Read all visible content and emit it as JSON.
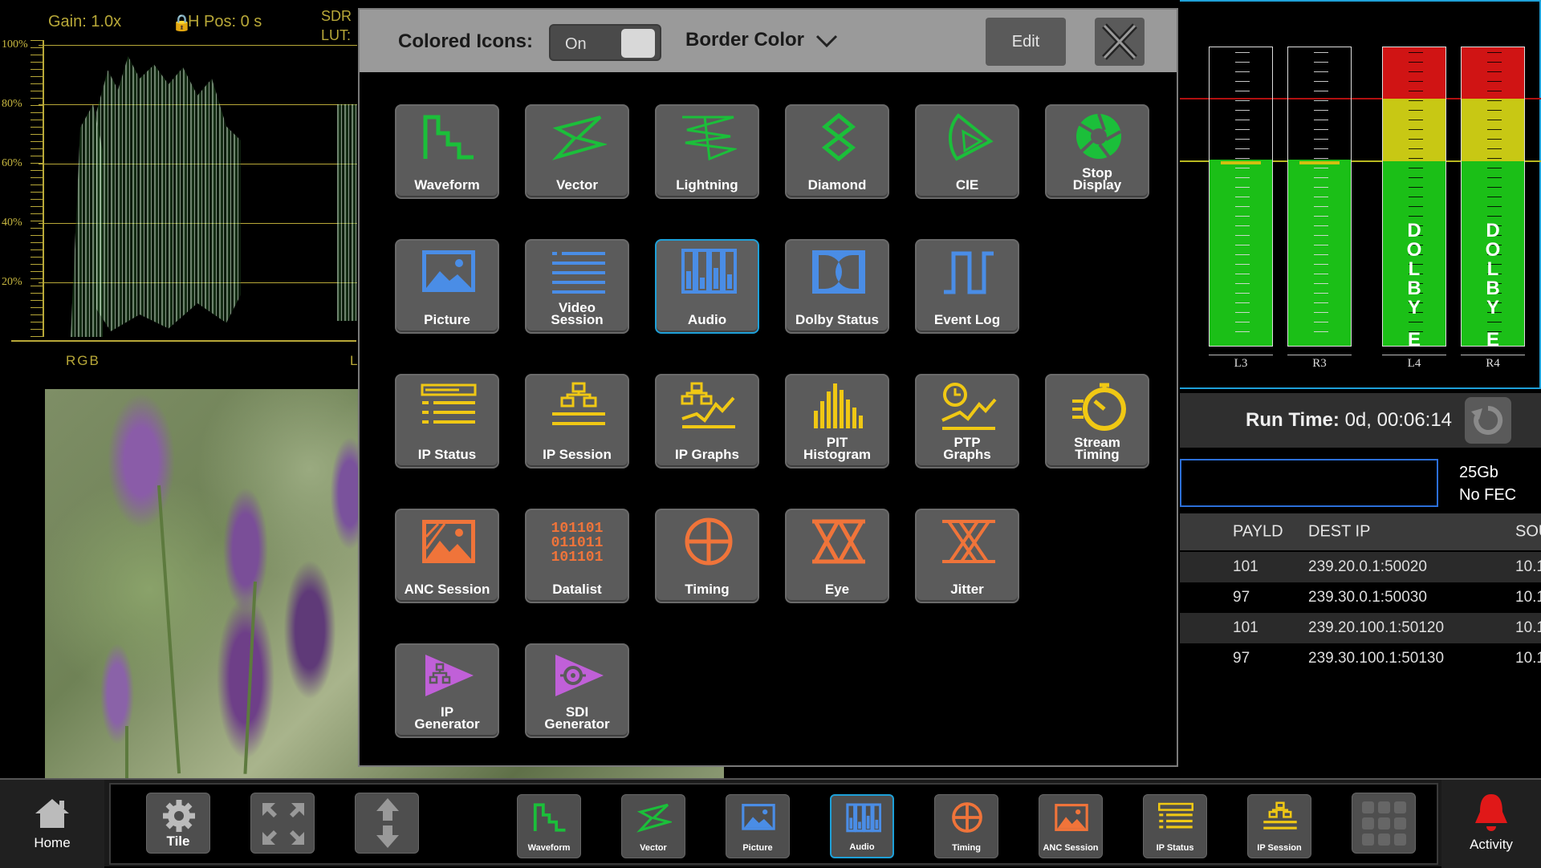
{
  "waveform": {
    "gain": "Gain: 1.0x",
    "hpos": "H Pos: 0 s",
    "sdr": "SDR",
    "lut": "LUT:",
    "scale": [
      "100%",
      "80%",
      "60%",
      "40%",
      "20%"
    ],
    "mode": "RGB",
    "right_mark": "L",
    "colors": {
      "graticule": "#b8a838"
    }
  },
  "audio": {
    "channels": [
      {
        "label": "L3",
        "level": 0.7,
        "dolby": false
      },
      {
        "label": "R3",
        "level": 0.7,
        "dolby": false
      },
      {
        "label": "L4",
        "level": 1.0,
        "dolby": true,
        "dolby_text": [
          "D",
          "O",
          "L",
          "B",
          "Y",
          "E"
        ]
      },
      {
        "label": "R4",
        "level": 1.0,
        "dolby": true,
        "dolby_text": [
          "D",
          "O",
          "L",
          "B",
          "Y",
          "E"
        ]
      }
    ],
    "colors": {
      "green": "#1bbf17",
      "yellow": "#c8c814",
      "red": "#d01414"
    }
  },
  "runtime": {
    "label": "Run Time:",
    "value": "0d, 00:06:14"
  },
  "link": {
    "speed": "25Gb",
    "fec": "No FEC"
  },
  "ip_table": {
    "columns": [
      "PAYLD",
      "DEST IP",
      "SOU"
    ],
    "rows": [
      [
        "101",
        "239.20.0.1:50020",
        "10.1"
      ],
      [
        "97",
        "239.30.0.1:50030",
        "10.1"
      ],
      [
        "101",
        "239.20.100.1:50120",
        "10.1"
      ],
      [
        "97",
        "239.30.100.1:50130",
        "10.1"
      ]
    ]
  },
  "modal": {
    "colored_icons_label": "Colored Icons:",
    "toggle_value": "On",
    "border_color_label": "Border Color",
    "edit_label": "Edit",
    "tiles": [
      {
        "label": "Waveform",
        "icon": "waveform-icon",
        "color": "#1bbf3a"
      },
      {
        "label": "Vector",
        "icon": "vector-icon",
        "color": "#1bbf3a"
      },
      {
        "label": "Lightning",
        "icon": "lightning-icon",
        "color": "#1bbf3a"
      },
      {
        "label": "Diamond",
        "icon": "diamond-icon",
        "color": "#1bbf3a"
      },
      {
        "label": "CIE",
        "icon": "cie-icon",
        "color": "#1bbf3a"
      },
      {
        "label": "Stop\nDisplay",
        "icon": "stop-display-icon",
        "color": "#1bbf3a"
      },
      {
        "label": "Picture",
        "icon": "picture-icon",
        "color": "#4a8de6"
      },
      {
        "label": "Video\nSession",
        "icon": "video-session-icon",
        "color": "#4a8de6"
      },
      {
        "label": "Audio",
        "icon": "audio-icon",
        "color": "#4a8de6",
        "selected": true
      },
      {
        "label": "Dolby Status",
        "icon": "dolby-status-icon",
        "color": "#4a8de6"
      },
      {
        "label": "Event Log",
        "icon": "event-log-icon",
        "color": "#4a8de6"
      },
      {
        "label": "IP Status",
        "icon": "ip-status-icon",
        "color": "#f0c814"
      },
      {
        "label": "IP Session",
        "icon": "ip-session-icon",
        "color": "#f0c814"
      },
      {
        "label": "IP Graphs",
        "icon": "ip-graphs-icon",
        "color": "#f0c814"
      },
      {
        "label": "PIT\nHistogram",
        "icon": "pit-histogram-icon",
        "color": "#f0c814"
      },
      {
        "label": "PTP\nGraphs",
        "icon": "ptp-graphs-icon",
        "color": "#f0c814"
      },
      {
        "label": "Stream\nTiming",
        "icon": "stream-timing-icon",
        "color": "#f0c814"
      },
      {
        "label": "ANC Session",
        "icon": "anc-session-icon",
        "color": "#f0743a"
      },
      {
        "label": "Datalist",
        "icon": "datalist-icon",
        "color": "#f0743a",
        "glyph": [
          "101101",
          "011011",
          "101101"
        ]
      },
      {
        "label": "Timing",
        "icon": "timing-icon",
        "color": "#f0743a"
      },
      {
        "label": "Eye",
        "icon": "eye-icon",
        "color": "#f0743a"
      },
      {
        "label": "Jitter",
        "icon": "jitter-icon",
        "color": "#f0743a"
      },
      {
        "label": "IP\nGenerator",
        "icon": "ip-generator-icon",
        "color": "#c060d8"
      },
      {
        "label": "SDI\nGenerator",
        "icon": "sdi-generator-icon",
        "color": "#c060d8"
      }
    ]
  },
  "bottom_bar": {
    "home": "Home",
    "tile": "Tile",
    "activity": "Activity",
    "shortcuts": [
      {
        "label": "Waveform",
        "icon": "waveform-icon"
      },
      {
        "label": "Vector",
        "icon": "vector-icon"
      },
      {
        "label": "Picture",
        "icon": "picture-icon"
      },
      {
        "label": "Audio",
        "icon": "audio-icon",
        "selected": true
      },
      {
        "label": "Timing",
        "icon": "timing-icon"
      },
      {
        "label": "ANC Session",
        "icon": "anc-session-icon"
      },
      {
        "label": "IP Status",
        "icon": "ip-status-icon"
      },
      {
        "label": "IP Session",
        "icon": "ip-session-icon"
      }
    ]
  }
}
